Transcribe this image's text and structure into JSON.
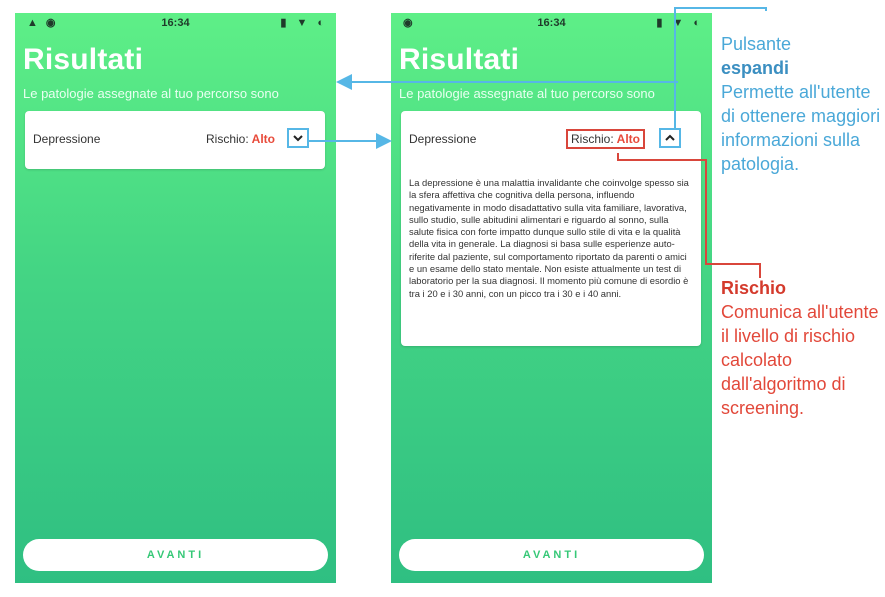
{
  "status_bar": {
    "time": "16:34"
  },
  "screen": {
    "title": "Risultati",
    "subtitle": "Le patologie assegnate al tuo percorso sono",
    "pathology": {
      "name": "Depressione",
      "risk_label": "Rischio:",
      "risk_value": "Alto",
      "description": "La depressione è una malattia invalidante che coinvolge spesso sia la sfera affettiva che cognitiva della persona, influendo negativamente in modo disadattativo sulla vita familiare, lavorativa, sullo studio, sulle abitudini alimentari e riguardo al sonno, sulla salute fisica con forte impatto dunque sullo stile di vita e la qualità della vita in generale. La diagnosi si basa sulle esperienze auto-riferite dal paziente, sul comportamento riportato da parenti o amici e un esame dello stato mentale. Non esiste attualmente un test di laboratorio per la sua diagnosi. Il momento più comune di esordio è tra i 20 e i 30 anni, con un picco tra i 30 e i 40 anni."
    },
    "next_button": "AVANTI"
  },
  "annotations": {
    "expand": {
      "line1": "Pulsante",
      "bold": "espandi",
      "text": "Permette all'utente di ottenere maggiori informazioni sulla patologia."
    },
    "risk": {
      "bold": "Rischio",
      "text": "Comunica all'utente il livello di rischio calcolato dall'algoritmo di screening."
    }
  },
  "colors": {
    "gradient_top": "#5eef87",
    "gradient_bottom": "#2fbf82",
    "risk_red": "#e84a3a",
    "expand_blue": "#56b7e6",
    "button_text_green": "#36c877"
  },
  "icons": {
    "expand_collapsed": "chevron-down-icon",
    "expand_open": "chevron-up-icon"
  }
}
